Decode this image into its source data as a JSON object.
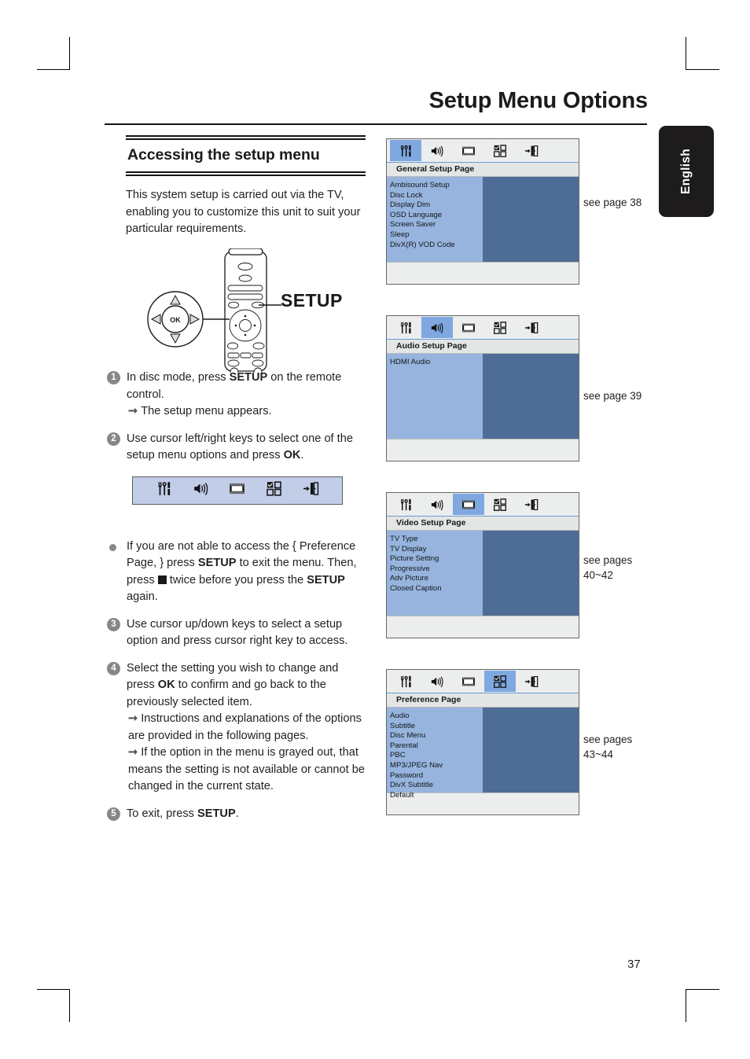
{
  "header": {
    "title": "Setup Menu Options",
    "language_tab": "English"
  },
  "page_number": "37",
  "left_column": {
    "section_heading": "Accessing the setup menu",
    "intro_paragraph": "This system setup is carried out via the TV, enabling you to customize this unit to suit your particular requirements.",
    "remote_callout_label": "SETUP",
    "steps": [
      {
        "num": "1",
        "text_before": "In disc mode, press ",
        "bold": "SETUP",
        "text_after": " on the remote control.",
        "sub_items": [
          "The setup menu appears."
        ]
      },
      {
        "num": "2",
        "text_before": "Use cursor left/right keys to select one of the setup menu options and press ",
        "bold": "OK",
        "text_after": ".",
        "sub_items": []
      },
      {
        "num": "3",
        "text_before": "Use cursor up/down keys to select a setup option and press cursor right key to access.",
        "bold": "",
        "text_after": "",
        "sub_items": []
      },
      {
        "num": "4",
        "text_before": "Select the setting you wish to change and press ",
        "bold": "OK",
        "text_after": " to confirm and go back to the previously selected item.",
        "sub_items": [
          "Instructions and explanations of the options are provided in the following pages.",
          "If the option in the menu is grayed out, that means the setting is not available or cannot be changed in the current state."
        ]
      },
      {
        "num": "5",
        "text_before": "To exit, press ",
        "bold": "SETUP",
        "text_after": ".",
        "sub_items": []
      }
    ],
    "bullet_note": {
      "part1": "If you are not able to access the { Preference Page, } press ",
      "bold1": "SETUP",
      "part2": " to exit the menu.  Then, press ",
      "stop_icon": "stop-button-icon",
      "part3": " twice before you press the ",
      "bold2": "SETUP",
      "part4": " again."
    }
  },
  "icon_strip": {
    "icons": [
      "general-setup-icon",
      "audio-setup-icon",
      "video-setup-icon",
      "preference-icon",
      "exit-setup-icon"
    ]
  },
  "osd_panels": [
    {
      "name": "general",
      "active_tab_index": 0,
      "title": "General Setup Page",
      "items": [
        "Ambisound Setup",
        "Disc Lock",
        "Display Dim",
        "OSD Language",
        "Screen Saver",
        "Sleep",
        "DivX(R) VOD Code"
      ],
      "see_note": "see page 38"
    },
    {
      "name": "audio",
      "active_tab_index": 1,
      "title": "Audio Setup Page",
      "items": [
        "HDMI Audio"
      ],
      "see_note": "see page 39"
    },
    {
      "name": "video",
      "active_tab_index": 2,
      "title": "Video Setup Page",
      "items": [
        "TV Type",
        "TV Display",
        "Picture Setting",
        "Progressive",
        "Adv Picture",
        "Closed Caption"
      ],
      "see_note": "see pages 40~42"
    },
    {
      "name": "preference",
      "active_tab_index": 3,
      "title": "Preference Page",
      "items": [
        "Audio",
        "Subtitle",
        "Disc Menu",
        "Parental",
        "PBC",
        "MP3/JPEG Nav",
        "Password",
        "DivX Subtitle",
        "Default"
      ],
      "see_note": "see pages 43~44"
    }
  ],
  "colors": {
    "osd_tab_active": "#7fa8e0",
    "osd_left_pane": "#96b4dd",
    "osd_right_pane": "#4e6d96",
    "icon_strip_bg": "#c2cde8",
    "lang_tab_bg": "#1d1b1b"
  }
}
